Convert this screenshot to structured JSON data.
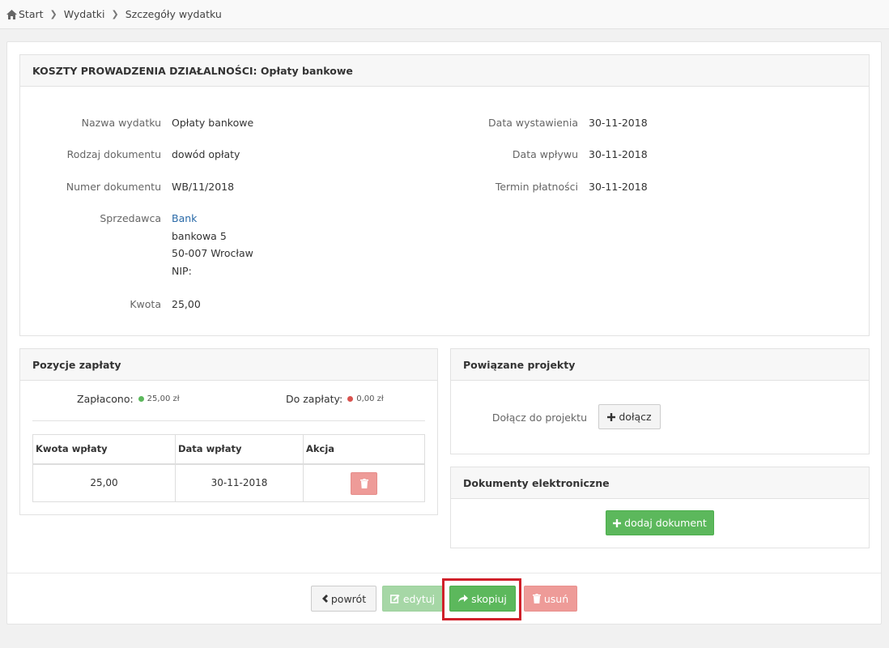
{
  "breadcrumb": {
    "start": "Start",
    "expenses": "Wydatki",
    "current": "Szczegóły wydatku"
  },
  "main_panel": {
    "title": "KOSZTY PROWADZENIA DZIAŁALNOŚCI: Opłaty bankowe",
    "left_fields": [
      {
        "label": "Nazwa wydatku",
        "value": "Opłaty bankowe"
      },
      {
        "label": "Rodzaj dokumentu",
        "value": "dowód opłaty"
      },
      {
        "label": "Numer dokumentu",
        "value": "WB/11/2018"
      }
    ],
    "seller": {
      "label": "Sprzedawca",
      "name": "Bank",
      "street": "bankowa 5",
      "city": "50-007 Wrocław",
      "nip": "NIP:"
    },
    "amount": {
      "label": "Kwota",
      "value": "25,00"
    },
    "right_fields": [
      {
        "label": "Data wystawienia",
        "value": "30-11-2018"
      },
      {
        "label": "Data wpływu",
        "value": "30-11-2018"
      },
      {
        "label": "Termin płatności",
        "value": "30-11-2018"
      }
    ]
  },
  "payments": {
    "title": "Pozycje zapłaty",
    "paid_label": "Zapłacono:",
    "paid_value": "25,00 zł",
    "due_label": "Do zapłaty:",
    "due_value": "0,00 zł",
    "columns": [
      "Kwota wpłaty",
      "Data wpłaty",
      "Akcja"
    ],
    "rows": [
      {
        "amount": "25,00",
        "date": "30-11-2018"
      }
    ]
  },
  "projects": {
    "title": "Powiązane projekty",
    "join_label": "Dołącz do projektu",
    "join_button": "dołącz"
  },
  "documents": {
    "title": "Dokumenty elektroniczne",
    "add_button": "dodaj dokument"
  },
  "actions": {
    "back": "powrót",
    "edit": "edytuj",
    "copy": "skopiuj",
    "delete": "usuń"
  },
  "colors": {
    "success": "#5cb85c",
    "danger": "#d9534f",
    "highlight": "#d0202a",
    "link": "#2a6aa8"
  }
}
